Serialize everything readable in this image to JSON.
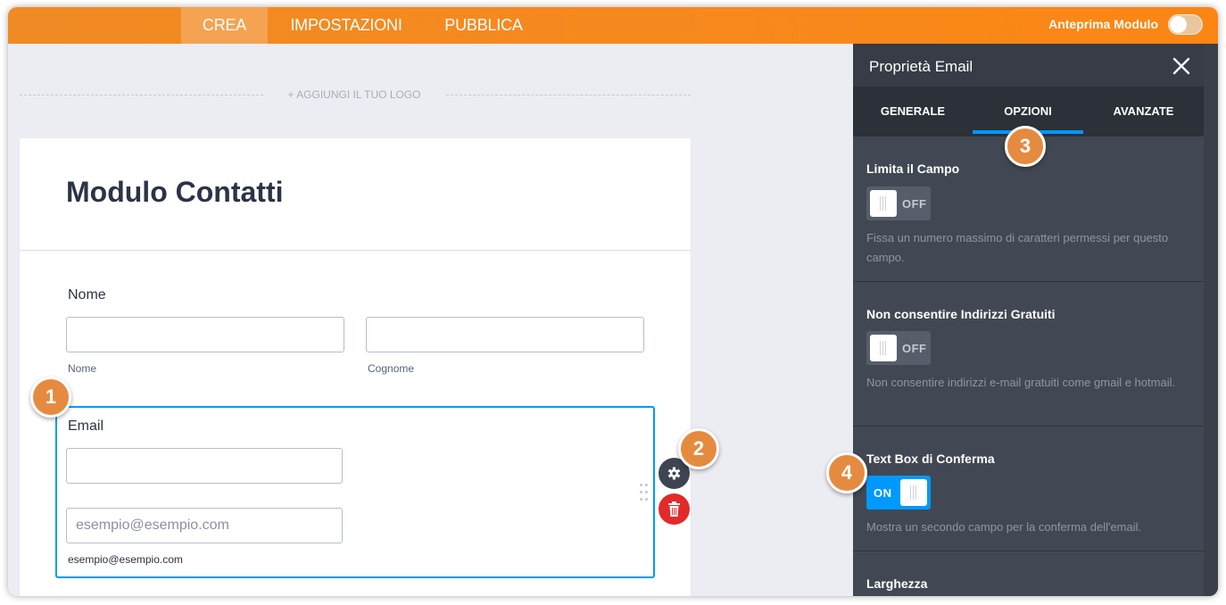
{
  "topbar": {
    "tabs": [
      {
        "label": "CREA",
        "active": true
      },
      {
        "label": "IMPOSTAZIONI",
        "active": false
      },
      {
        "label": "PUBBLICA",
        "active": false
      }
    ],
    "preview_label": "Anteprima Modulo",
    "preview_on": false,
    "accent_color": "#f7891d"
  },
  "form": {
    "add_logo": "+ AGGIUNGI IL TUO LOGO",
    "title": "Modulo Contatti",
    "name_field": {
      "label": "Nome",
      "first_sublabel": "Nome",
      "last_sublabel": "Cognome",
      "first_value": "",
      "last_value": ""
    },
    "email_field": {
      "label": "Email",
      "value": "",
      "confirm_placeholder": "esempio@esempio.com",
      "sublabel": "esempio@esempio.com"
    },
    "actions": {
      "settings_icon": "gear-icon",
      "delete_icon": "trash-icon",
      "delete_color": "#e22a2a"
    }
  },
  "panel": {
    "title": "Proprietà Email",
    "close_icon": "close-icon",
    "tabs": [
      {
        "label": "GENERALE",
        "active": false
      },
      {
        "label": "OPZIONI",
        "active": true
      },
      {
        "label": "AVANZATE",
        "active": false
      }
    ],
    "sections": [
      {
        "title": "Limita il Campo",
        "toggle": "OFF",
        "description": "Fissa un numero massimo di caratteri permessi per questo campo."
      },
      {
        "title": "Non consentire Indirizzi Gratuiti",
        "toggle": "OFF",
        "description": "Non consentire indirizzi e-mail gratuiti come gmail e hotmail."
      },
      {
        "title": "Text Box di Conferma",
        "toggle": "ON",
        "description": "Mostra un secondo campo per la conferma dell'email."
      },
      {
        "title": "Larghezza"
      }
    ],
    "active_color": "#0099ff"
  },
  "badges": [
    "1",
    "2",
    "3",
    "4"
  ],
  "badge_color": "#e58b40"
}
